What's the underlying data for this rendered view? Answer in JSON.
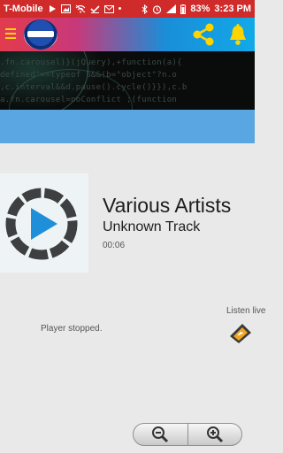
{
  "status_bar": {
    "carrier": "T-Mobile",
    "battery": "83%",
    "time": "3:23 PM",
    "color": "#cf2b2b"
  },
  "header": {
    "menu_icon": "hamburger-menu-icon",
    "logo_icon": "station-logo-icon",
    "share_icon": "share-icon",
    "bell_icon": "bell-icon",
    "accent": "#ffd400"
  },
  "banner": {
    "code_lines": [
      "  .fn.carousel)}(jQuery),+function(a){",
      "defined\"==typeof b&&(b=\"object\"?n.o",
      "  ,c.interval&&d.pause().cycle()}}),c.b",
      "  a.fn.carousel=noConflict     ;(function"
    ]
  },
  "player": {
    "artist": "Various Artists",
    "track": "Unknown Track",
    "elapsed": "00:06",
    "status": "Player stopped.",
    "listen_label": "Listen live",
    "art_icon": "play-icon"
  },
  "zoom": {
    "out_icon": "zoom-out-icon",
    "in_icon": "zoom-in-icon"
  }
}
